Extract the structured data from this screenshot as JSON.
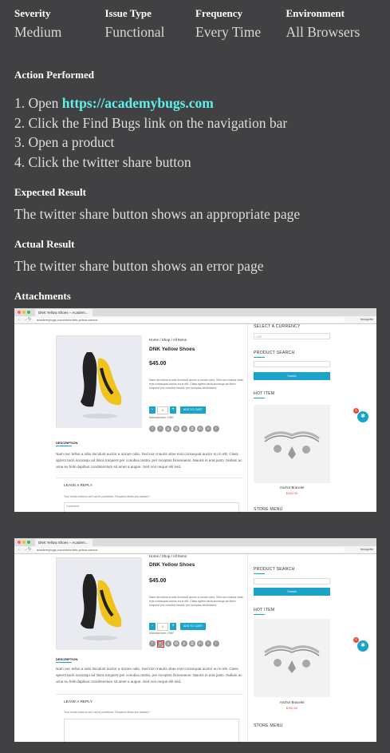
{
  "header": {
    "columns": [
      {
        "label": "Severity",
        "value": "Medium"
      },
      {
        "label": "Issue Type",
        "value": "Functional"
      },
      {
        "label": "Frequency",
        "value": "Every Time"
      },
      {
        "label": "Environment",
        "value": "All Browsers"
      }
    ]
  },
  "action": {
    "title": "Action Performed",
    "steps": [
      {
        "num": "1.",
        "prefix": "Open ",
        "link": "https://academybugs.com"
      },
      {
        "num": "2.",
        "text": "Click the Find Bugs link on the navigation bar"
      },
      {
        "num": "3.",
        "text": "Open a product"
      },
      {
        "num": "4.",
        "text": "Click the twitter share button"
      }
    ]
  },
  "expected": {
    "title": "Expected Result",
    "text": "The twitter share button shows an appropriate page"
  },
  "actual": {
    "title": "Actual Result",
    "text": "The twitter share button shows an error page"
  },
  "attachments": {
    "title": "Attachments",
    "shots": [
      {
        "tab": "DNK Yellow Shoes – Academ...",
        "url": "academybugs.com/store/dnk-yellow-shoes/",
        "user": "Incognito",
        "breadcrumb": "Home / Shop / All Items",
        "product_title": "DNK Yellow Shoes",
        "price": "$45.00",
        "desc": "Nam nec tellus a odio tincidunt auctor a ornare odio. Sed non mauris vitae erat consequat auctor eu in elit. Class aptent taciti sociosqu ad litora torquent per conubia nostra, per inceptos himenaeos.",
        "manufacturer": "Manufacturer: DNK",
        "qty": "1",
        "add_to_cart": "ADD TO CART",
        "description_tab": "DESCRIPTION",
        "description_text": "Nam nec tellus a odio tincidunt auctor a ornare odio. Sed non mauris vitae erat consequat auctor eu in elit. Class aptent taciti sociosqu ad litora torquent per conubia nostra, per inceptos himenaeos. Mauris in erat justo. Nullam ac urna eu felis dapibus condimentum sit amet a augue. Sed non neque elit sed.",
        "reply_title": "LEAVE A REPLY",
        "reply_note": "Your email address will not be published. Required fields are marked *",
        "comment_placeholder": "Comment",
        "sidebar_currency": "SELECT A CURRENCY",
        "currency_value": "USD",
        "sidebar_search": "PRODUCT SEARCH",
        "search_button": "Search",
        "hot_title": "HOT ITEM",
        "hot_name": "Anchor Bracelet",
        "hot_price": "$150.00",
        "store_menu": "STORE MENU",
        "bug_count": "8"
      },
      {
        "tab": "DNK Yellow Shoes – Academ...",
        "url": "academybugs.com/store/dnk-yellow-shoes/",
        "user": "Incognito",
        "breadcrumb": "Home / Shop / All Items",
        "product_title": "DNK Yellow Shoes",
        "price": "$45.00",
        "desc": "Nam nec tellus a odio tincidunt auctor a ornare odio. Sed non mauris vitae erat consequat auctor eu in elit. Class aptent taciti sociosqu ad litora torquent per conubia nostra, per inceptos himenaeos.",
        "manufacturer": "Manufacturer: DNK",
        "qty": "1",
        "add_to_cart": "ADD TO CART",
        "description_tab": "DESCRIPTION",
        "description_text": "Nam nec tellus a odio tincidunt auctor a ornare odio. Sed non mauris vitae erat consequat auctor eu in elit. Class aptent taciti sociosqu ad litora torquent per conubia nostra, per inceptos himenaeos. Mauris in erat justo. Nullam ac urna eu felis dapibus condimentum sit amet a augue. Sed non neque elit sed.",
        "reply_title": "LEAVE A REPLY",
        "reply_note": "Your email address will not be published. Required fields are marked *",
        "comment_placeholder": "Comment",
        "sidebar_search": "PRODUCT SEARCH",
        "search_button": "Search",
        "hot_title": "HOT ITEM",
        "hot_name": "Anchor Bracelet",
        "hot_price": "$150.00",
        "store_menu": "STORE MENU",
        "bug_count": "8"
      }
    ]
  },
  "colors": {
    "background": "#414143",
    "link": "#5ff0ea",
    "accent": "#1ba3c9",
    "highlight": "#e02020"
  }
}
